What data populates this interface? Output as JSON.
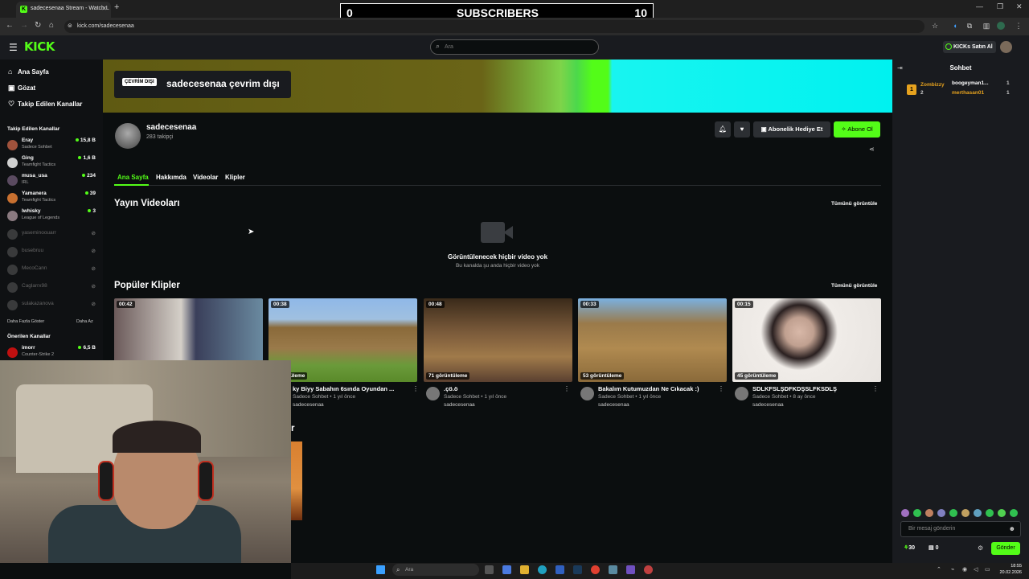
{
  "browser": {
    "tab_title": "sadecesenaa Stream - Watch L",
    "url": "kick.com/sadecesenaa"
  },
  "overlay": {
    "left": "0",
    "label": "SUBSCRIBERS",
    "right": "10"
  },
  "header": {
    "logo": "KICK",
    "search_placeholder": "Ara",
    "buy_kicks": "KICKs Satın Al"
  },
  "sidebar": {
    "nav": [
      "Ana Sayfa",
      "Gözat",
      "Takip Edilen Kanallar"
    ],
    "followed_title": "Takip Edilen Kanallar",
    "followed": [
      {
        "name": "Eray",
        "category": "Sadece Sohbet",
        "viewers": "15,8 B"
      },
      {
        "name": "Ging",
        "category": "Teamfight Tactics",
        "viewers": "1,6 B"
      },
      {
        "name": "musa_usa",
        "category": "IRL",
        "viewers": "234"
      },
      {
        "name": "Yamanera",
        "category": "Teamfight Tactics",
        "viewers": "39"
      },
      {
        "name": "lwhisky",
        "category": "League of Legends",
        "viewers": "3"
      }
    ],
    "offline": [
      "yaseminoouarr",
      "busebruu",
      "MecoCann",
      "Caglarrx98",
      "sulakazanova"
    ],
    "show_more": "Daha Fazla Göster",
    "show_less": "Daha Az",
    "recommended_title": "Önerilen Kanallar",
    "recommended": [
      {
        "name": "imorr",
        "category": "Counter-Strike 2",
        "viewers": "6,5 B"
      }
    ]
  },
  "banner": {
    "badge": "ÇEVRİM DIŞI",
    "text": "sadecesenaa çevrim dışı"
  },
  "channel": {
    "name": "sadecesenaa",
    "followers": "283 takipçi",
    "gift_button": "Abonelik Hediye Et",
    "subscribe_button": "Abone Ol"
  },
  "tabs": [
    "Ana Sayfa",
    "Hakkımda",
    "Videolar",
    "Klipler"
  ],
  "videos": {
    "title": "Yayın Videoları",
    "see_all": "Tümünü görüntüle",
    "empty_title": "Görüntülenecek hiçbir video yok",
    "empty_sub": "Bu kanalda şu anda hiçbir video yok"
  },
  "clips": {
    "title": "Popüler Klipler",
    "see_all": "Tümünü görüntüle",
    "items": [
      {
        "duration": "00:42",
        "views": "",
        "title": "",
        "sub": "",
        "channel": ""
      },
      {
        "duration": "00:38",
        "views": "görüntüleme",
        "title": "ky Biyy Sabahın 6sında Oyundan ...",
        "sub": "Sadece Sohbet • 1 yıl önce",
        "channel": "sadecesenaa"
      },
      {
        "duration": "00:48",
        "views": "71 görüntüleme",
        "title": ".çö.ö",
        "sub": "Sadece Sohbet • 1 yıl önce",
        "channel": "sadecesenaa"
      },
      {
        "duration": "00:33",
        "views": "53 görüntüleme",
        "title": "Bakalım Kutumuzdan Ne Cıkacak :)",
        "sub": "Sadece Sohbet • 1 yıl önce",
        "channel": "sadecesenaa"
      },
      {
        "duration": "00:15",
        "views": "45 görüntüleme",
        "title": "SDLKFSLŞDFKDŞSLFKSDLŞ",
        "sub": "Sadece Sohbet • 8 ay önce",
        "channel": "sadecesenaa"
      }
    ]
  },
  "third_section_fragment": "r",
  "chat": {
    "title": "Sohbet",
    "top_gifter": {
      "name": "Zombizzy",
      "count": "2"
    },
    "gifters": [
      {
        "name": "boogeyman1...",
        "count": "1"
      },
      {
        "name": "merthasan01",
        "count": "1"
      }
    ],
    "input_placeholder": "Bir mesaj gönderin",
    "kicks_count": "30",
    "store_count": "0",
    "send_label": "Gönder"
  },
  "taskbar": {
    "search_placeholder": "Ara",
    "time": "18:55",
    "date": "20.02.2026"
  },
  "colors": {
    "accent": "#53fc18",
    "bg": "#0b0e0f",
    "panel": "#191b1f"
  }
}
